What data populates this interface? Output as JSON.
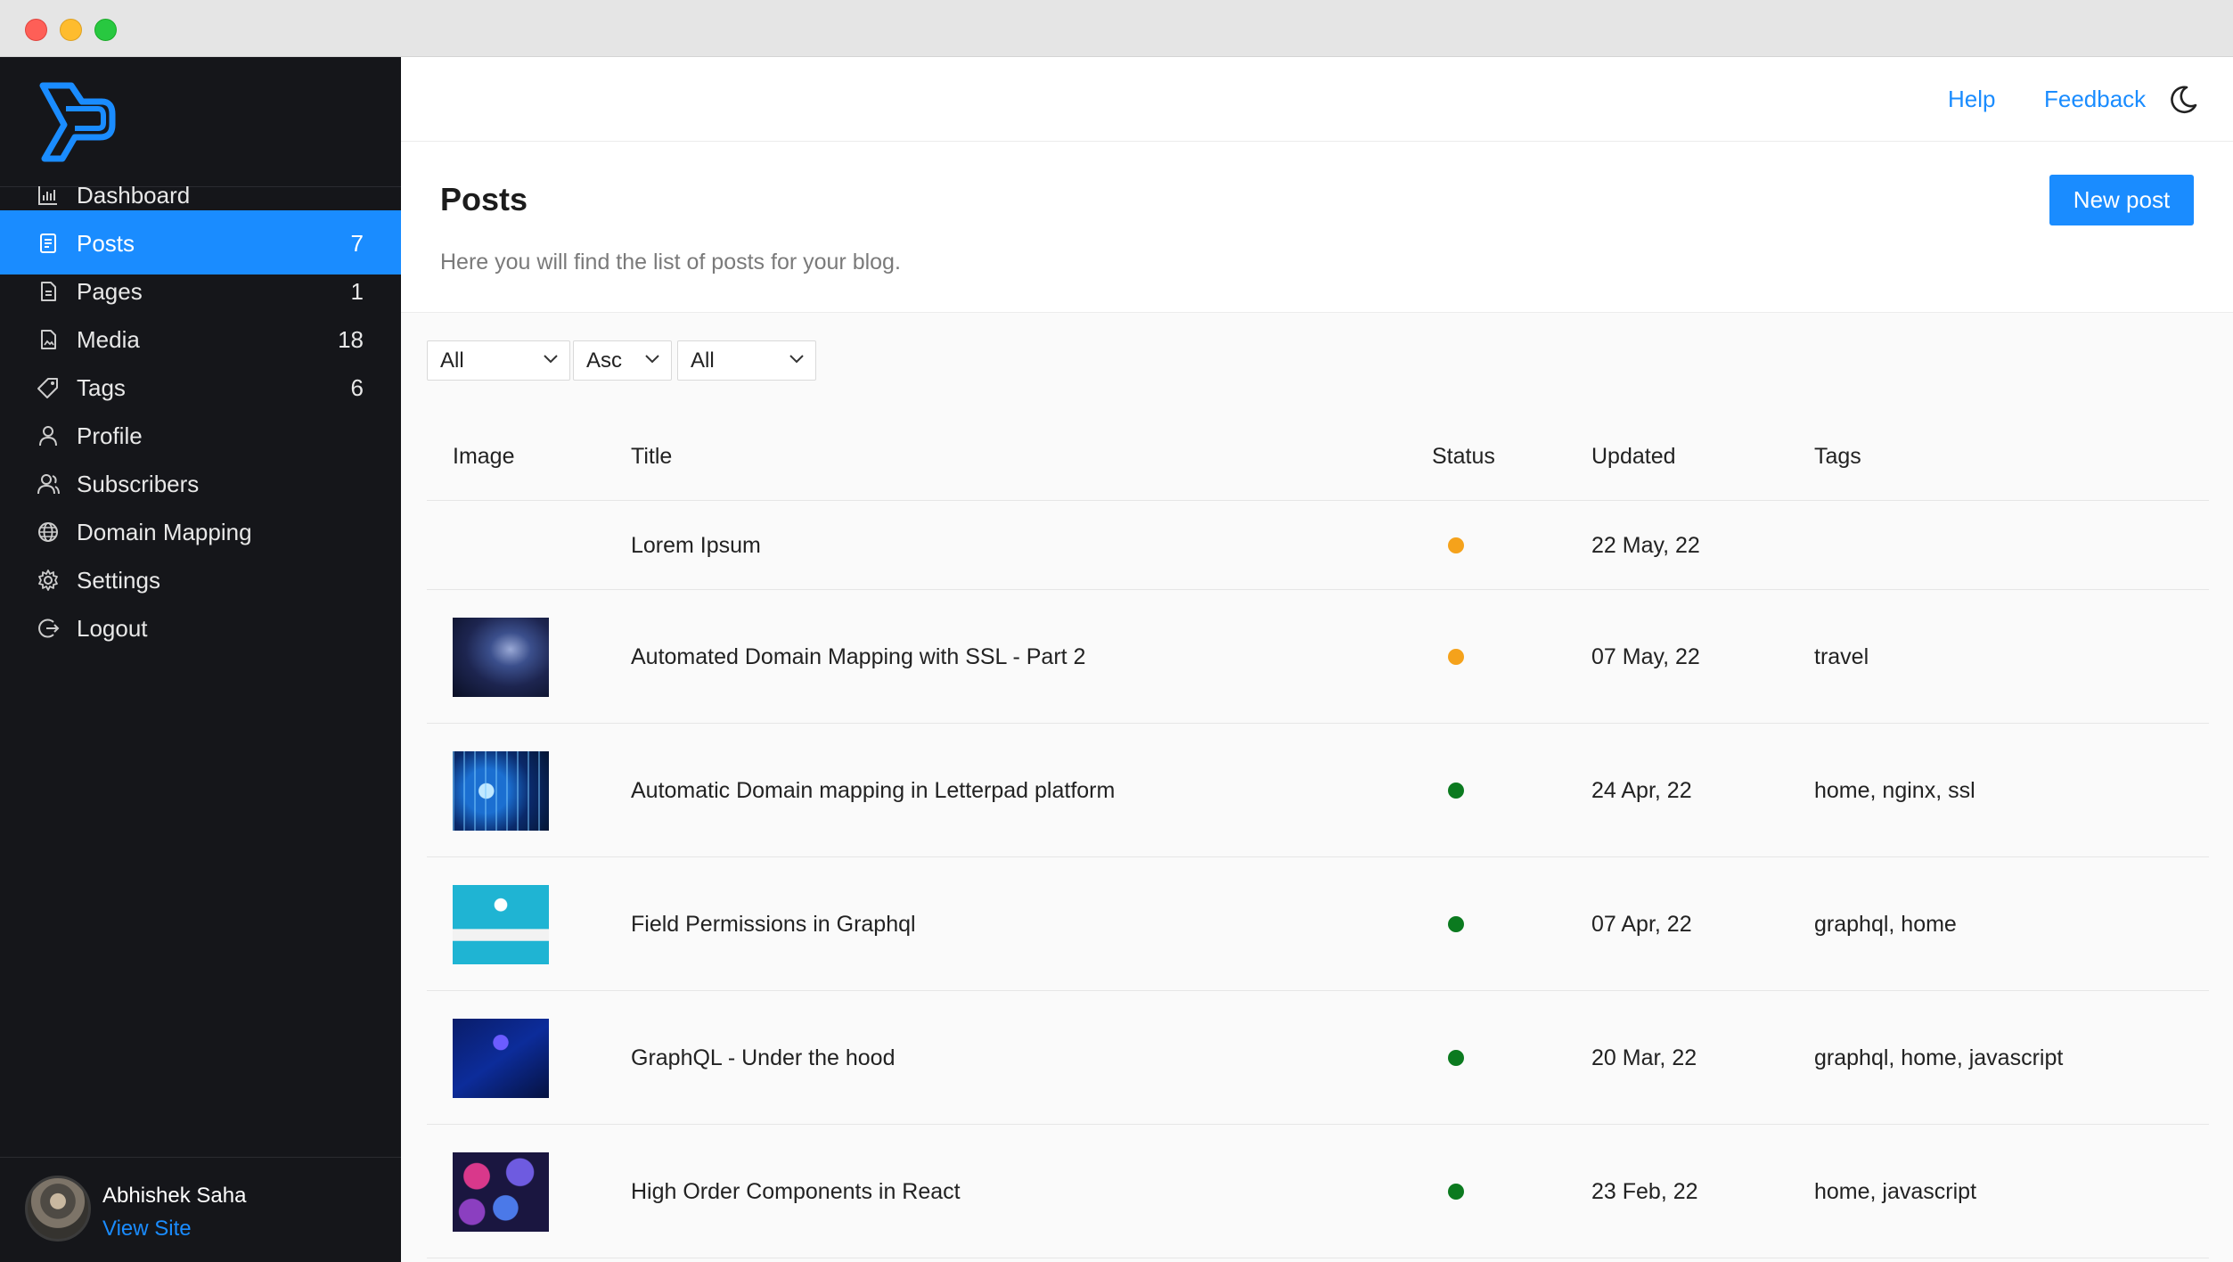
{
  "window": {
    "controls": [
      "close",
      "minimize",
      "maximize"
    ]
  },
  "sidebar": {
    "logo_icon": "letterpad-logo",
    "items": [
      {
        "label": "Dashboard",
        "count": "",
        "icon": "chart-icon",
        "active": false
      },
      {
        "label": "Posts",
        "count": "7",
        "icon": "document-icon",
        "active": true
      },
      {
        "label": "Pages",
        "count": "1",
        "icon": "page-icon",
        "active": false
      },
      {
        "label": "Media",
        "count": "18",
        "icon": "image-file-icon",
        "active": false
      },
      {
        "label": "Tags",
        "count": "6",
        "icon": "tag-icon",
        "active": false
      },
      {
        "label": "Profile",
        "count": "",
        "icon": "user-icon",
        "active": false
      },
      {
        "label": "Subscribers",
        "count": "",
        "icon": "users-icon",
        "active": false
      },
      {
        "label": "Domain Mapping",
        "count": "",
        "icon": "globe-icon",
        "active": false
      },
      {
        "label": "Settings",
        "count": "",
        "icon": "gear-icon",
        "active": false
      },
      {
        "label": "Logout",
        "count": "",
        "icon": "logout-icon",
        "active": false
      }
    ],
    "user": {
      "name": "Abhishek Saha",
      "link": "View Site"
    }
  },
  "topbar": {
    "help": "Help",
    "feedback": "Feedback",
    "theme_icon": "moon-icon"
  },
  "header": {
    "title": "Posts",
    "subtitle": "Here you will find the list of posts for your blog.",
    "new_post": "New post"
  },
  "filters": [
    {
      "selected": "All"
    },
    {
      "selected": "Asc"
    },
    {
      "selected": "All"
    }
  ],
  "table": {
    "columns": [
      "Image",
      "Title",
      "Status",
      "Updated",
      "Tags"
    ],
    "rows": [
      {
        "image": "",
        "title": "Lorem Ipsum",
        "status": "draft",
        "status_color": "#f5a21b",
        "updated": "22 May, 22",
        "tags": ""
      },
      {
        "image": "galaxy",
        "title": "Automated Domain Mapping with SSL - Part 2",
        "status": "draft",
        "status_color": "#f5a21b",
        "updated": "07 May, 22",
        "tags": "travel"
      },
      {
        "image": "circuit-key",
        "title": "Automatic Domain mapping in Letterpad platform",
        "status": "published",
        "status_color": "#0b7a1f",
        "updated": "24 Apr, 22",
        "tags": "home, nginx, ssl"
      },
      {
        "image": "lock-illustration",
        "title": "Field Permissions in Graphql",
        "status": "published",
        "status_color": "#0b7a1f",
        "updated": "07 Apr, 22",
        "tags": "graphql, home"
      },
      {
        "image": "graphql-chip",
        "title": "GraphQL - Under the hood",
        "status": "published",
        "status_color": "#0b7a1f",
        "updated": "20 Mar, 22",
        "tags": "graphql, home, javascript"
      },
      {
        "image": "react-hexagons",
        "title": "High Order Components in React",
        "status": "published",
        "status_color": "#0b7a1f",
        "updated": "23 Feb, 22",
        "tags": "home, javascript"
      }
    ]
  },
  "colors": {
    "accent": "#1a8cff",
    "sidebar_bg": "#15161a",
    "draft": "#f5a21b",
    "published": "#0b7a1f"
  }
}
